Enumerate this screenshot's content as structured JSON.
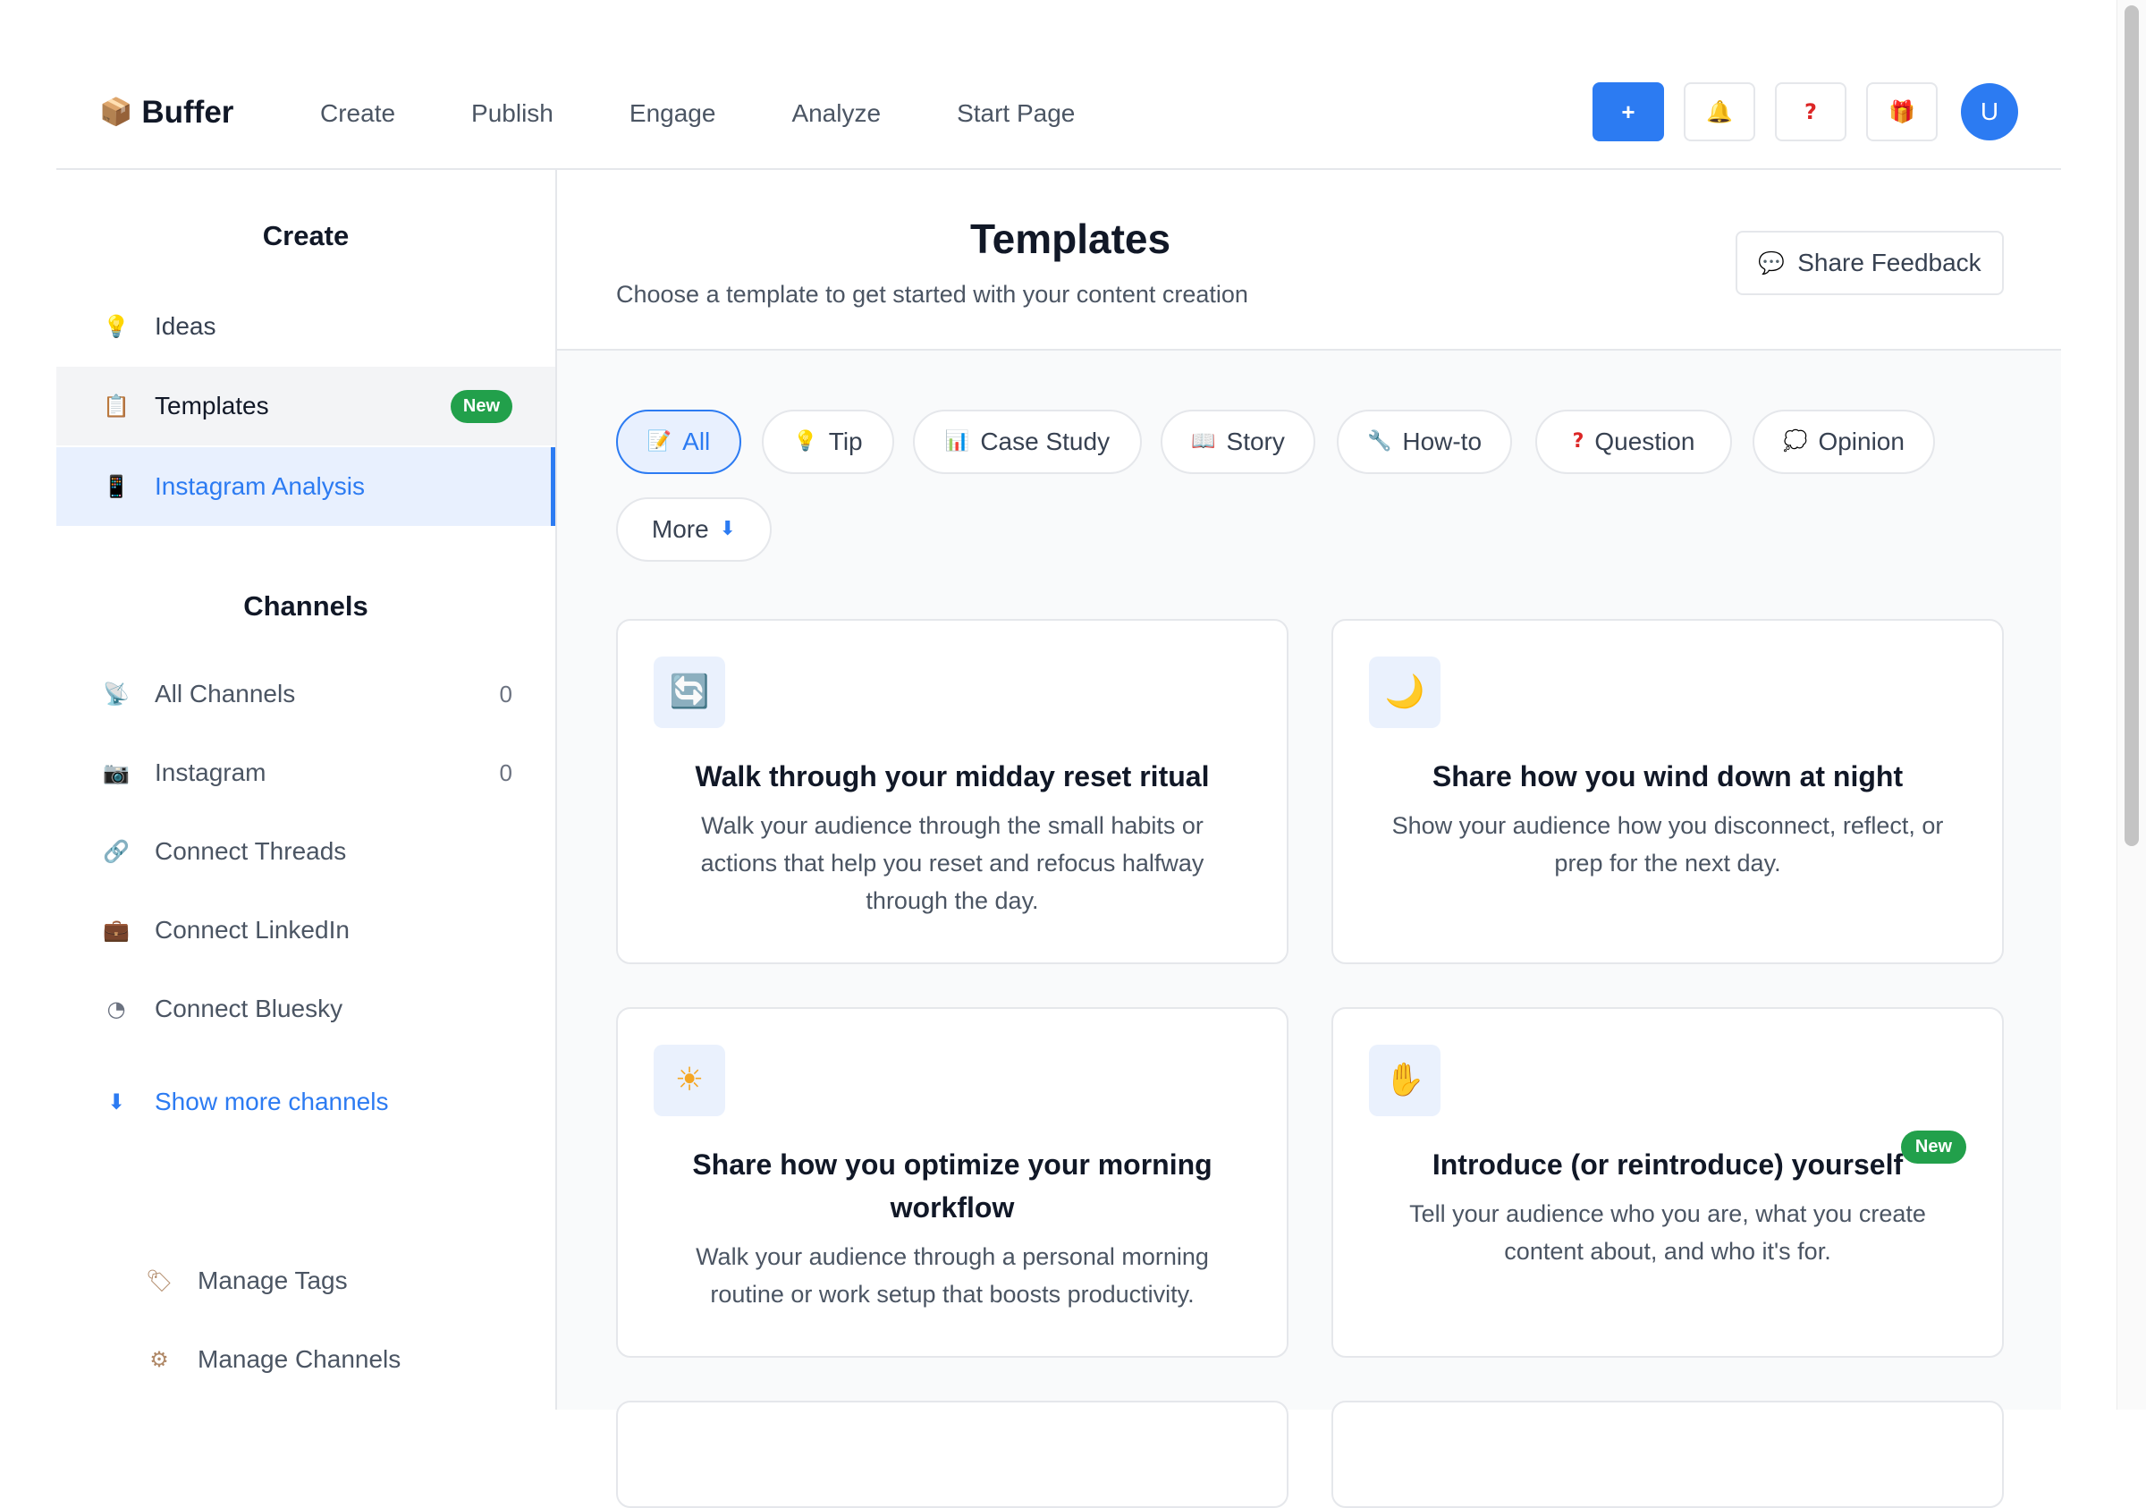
{
  "app": {
    "name": "Buffer"
  },
  "topnav": [
    "Create",
    "Publish",
    "Engage",
    "Analyze",
    "Start Page"
  ],
  "top_actions": {
    "new_label": "+",
    "avatar_initial": "U"
  },
  "sidebar": {
    "create_heading": "Create",
    "create_items": [
      {
        "label": "Ideas",
        "icon": "lightbulb-icon"
      },
      {
        "label": "Templates",
        "icon": "clipboard-icon",
        "badge": "New"
      },
      {
        "label": "Instagram Analysis",
        "icon": "mobile-phone-icon"
      }
    ],
    "channels_heading": "Channels",
    "channels": [
      {
        "label": "All Channels",
        "count": "0",
        "icon": "satellite-icon"
      },
      {
        "label": "Instagram",
        "count": "0",
        "icon": "camera-icon"
      },
      {
        "label": "Connect Threads",
        "icon": "link-icon"
      },
      {
        "label": "Connect LinkedIn",
        "icon": "briefcase-icon"
      },
      {
        "label": "Connect Bluesky",
        "icon": "bluesky-icon"
      }
    ],
    "show_more": "Show more channels",
    "manage": [
      {
        "label": "Manage Tags",
        "icon": "tag-icon"
      },
      {
        "label": "Manage Channels",
        "icon": "gear-icon"
      }
    ]
  },
  "main": {
    "title": "Templates",
    "subtitle": "Choose a template to get started with your content creation",
    "feedback_label": "Share Feedback",
    "filters": [
      {
        "label": "All",
        "icon": "memo-icon",
        "active": true
      },
      {
        "label": "Tip",
        "icon": "lightbulb-icon"
      },
      {
        "label": "Case Study",
        "icon": "bar-chart-icon"
      },
      {
        "label": "Story",
        "icon": "book-icon"
      },
      {
        "label": "How-to",
        "icon": "wrench-icon"
      },
      {
        "label": "Question",
        "icon": "question-icon"
      },
      {
        "label": "Opinion",
        "icon": "thought-bubble-icon"
      },
      {
        "label": "More",
        "icon": "down-arrow-icon"
      }
    ],
    "cards": [
      {
        "title": "Walk through your midday reset ritual",
        "description": "Walk your audience through the small habits or actions that help you reset and refocus halfway through the day.",
        "icon": "refresh-icon"
      },
      {
        "title": "Share how you wind down at night",
        "description": "Show your audience how you disconnect, reflect, or prep for the next day.",
        "icon": "moon-icon"
      },
      {
        "title": "Share how you optimize your morning workflow",
        "description": "Walk your audience through a personal morning routine or work setup that boosts productivity.",
        "icon": "sun-icon"
      },
      {
        "title": "Introduce (or reintroduce) yourself",
        "description": "Tell your audience who you are, what you create content about, and who it's for.",
        "icon": "raised-hand-icon",
        "badge": "New"
      }
    ]
  },
  "colors": {
    "accent": "#2c7bf2",
    "badge_green": "#22a04b",
    "border": "#e5e7eb"
  }
}
